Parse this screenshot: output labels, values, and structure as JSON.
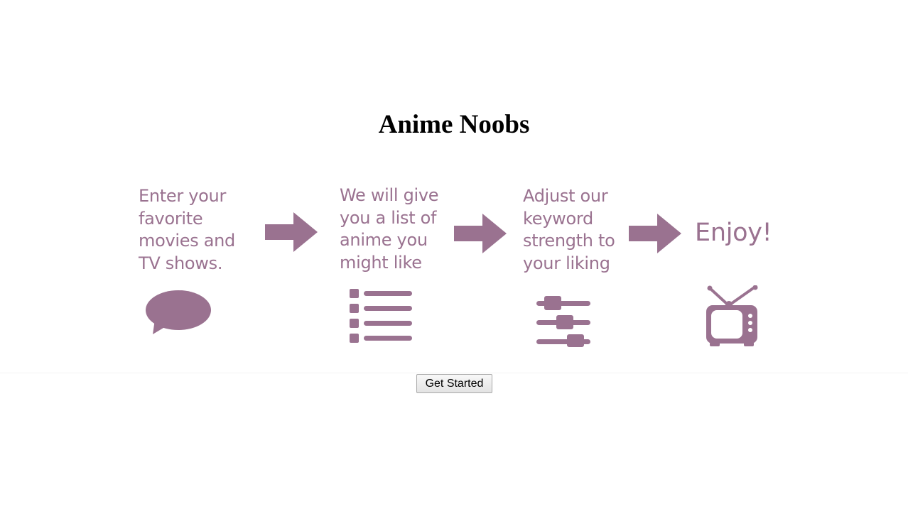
{
  "page": {
    "title": "Anime Noobs"
  },
  "steps": [
    {
      "lines": [
        "Enter your",
        "favorite",
        "movies and",
        "TV shows."
      ],
      "icon": "speech-bubble-icon"
    },
    {
      "lines": [
        "We will give",
        "you a list of",
        "anime you",
        "might like"
      ],
      "icon": "list-icon"
    },
    {
      "lines": [
        "Adjust our",
        "keyword",
        "strength to",
        "your liking"
      ],
      "icon": "sliders-icon"
    },
    {
      "lines": [
        "Enjoy!"
      ],
      "icon": "tv-icon"
    }
  ],
  "arrows": [
    "arrow-right-icon",
    "arrow-right-icon",
    "arrow-right-icon"
  ],
  "actions": {
    "get_started_label": "Get Started"
  },
  "colors": {
    "accent": "#9a7290",
    "background": "#ffffff",
    "title": "#000000"
  }
}
